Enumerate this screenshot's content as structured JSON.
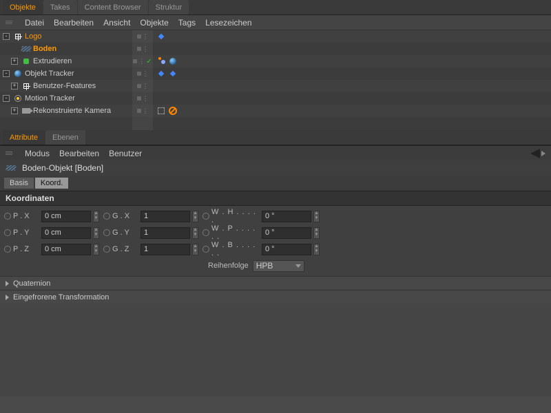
{
  "top_tabs": [
    {
      "label": "Objekte",
      "active": true
    },
    {
      "label": "Takes",
      "active": false
    },
    {
      "label": "Content Browser",
      "active": false
    },
    {
      "label": "Struktur",
      "active": false
    }
  ],
  "obj_menu": [
    "Datei",
    "Bearbeiten",
    "Ansicht",
    "Objekte",
    "Tags",
    "Lesezeichen"
  ],
  "tree": [
    {
      "name": "Logo",
      "icon": "null",
      "indent": 0,
      "expand": "-",
      "hl": "hl2"
    },
    {
      "name": "Boden",
      "icon": "floor",
      "indent": 1,
      "expand": "",
      "hl": "hl"
    },
    {
      "name": "Extrudieren",
      "icon": "extrude",
      "indent": 1,
      "expand": "+",
      "hl": ""
    },
    {
      "name": "Objekt Tracker",
      "icon": "globe",
      "indent": 0,
      "expand": "-",
      "hl": ""
    },
    {
      "name": "Benutzer-Features",
      "icon": "null",
      "indent": 1,
      "expand": "+",
      "hl": ""
    },
    {
      "name": "Motion Tracker",
      "icon": "track",
      "indent": 0,
      "expand": "-",
      "hl": ""
    },
    {
      "name": "Rekonstruierte Kamera",
      "icon": "cam",
      "indent": 1,
      "expand": "+",
      "hl": ""
    }
  ],
  "row_extras": {
    "2": {
      "check": true
    },
    "6": {
      "target": true,
      "prohibit": true
    }
  },
  "tag_rows": {
    "0": [
      "node"
    ],
    "2": [
      "orbit",
      "globe"
    ],
    "3": [
      "node",
      "node"
    ]
  },
  "attr_tabs": [
    {
      "label": "Attribute",
      "active": true
    },
    {
      "label": "Ebenen",
      "active": false
    }
  ],
  "attr_menu": [
    "Modus",
    "Bearbeiten",
    "Benutzer"
  ],
  "obj_title": "Boden-Objekt [Boden]",
  "subtabs": [
    {
      "label": "Basis",
      "active": false
    },
    {
      "label": "Koord.",
      "active": true
    }
  ],
  "section_coords": "Koordinaten",
  "coords": {
    "rows": [
      {
        "p": "P . X",
        "pv": "0 cm",
        "g": "G . X",
        "gv": "1",
        "w": "W . H . . . . .",
        "wv": "0 °"
      },
      {
        "p": "P . Y",
        "pv": "0 cm",
        "g": "G . Y",
        "gv": "1",
        "w": "W . P . . . . . .",
        "wv": "0 °"
      },
      {
        "p": "P . Z",
        "pv": "0 cm",
        "g": "G . Z",
        "gv": "1",
        "w": "W . B . . . . . .",
        "wv": "0 °"
      }
    ],
    "order_label": "Reihenfolge",
    "order_value": "HPB"
  },
  "collapsibles": [
    "Quaternion",
    "Eingefrorene Transformation"
  ]
}
